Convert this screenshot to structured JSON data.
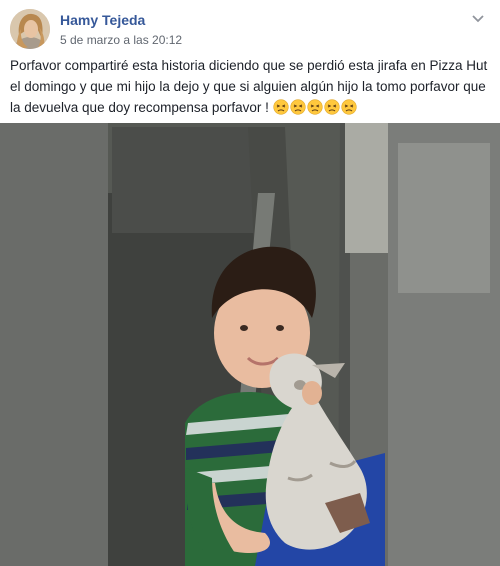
{
  "post": {
    "author": "Hamy Tejeda",
    "timestamp": "5 de marzo a las 20:12",
    "text": "Porfavor compartiré esta historia diciendo que se perdió esta jirafa en Pizza Hut el domingo y que mi hijo la dejo y que si alguien algún hijo la tomo porfavor que la devuelva que doy recompensa porfavor !",
    "emojis": [
      "persevering-face",
      "persevering-face",
      "persevering-face",
      "persevering-face",
      "persevering-face"
    ]
  },
  "colors": {
    "author_link": "#365899",
    "timestamp": "#616770",
    "body_text": "#1d2129",
    "emoji": "#ffc83d"
  }
}
